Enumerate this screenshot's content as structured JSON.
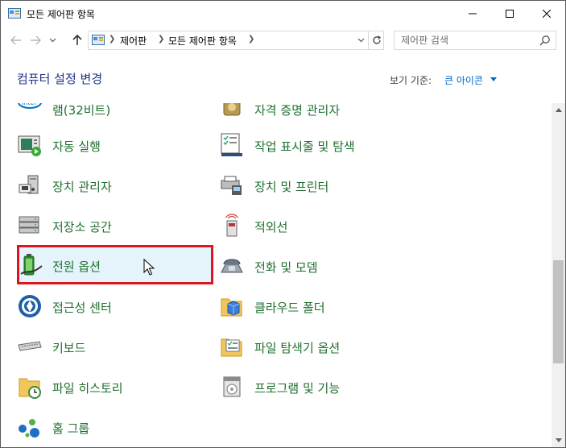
{
  "window": {
    "title": "모든 제어판 항목",
    "controls": {
      "minimize": "minimize",
      "maximize": "maximize",
      "close": "close"
    }
  },
  "address_bar": {
    "breadcrumbs": [
      "제어판",
      "모든 제어판 항목"
    ],
    "search_placeholder": "제어판 검색"
  },
  "header": {
    "title": "컴퓨터 설정 변경",
    "view_by_label": "보기 기준:",
    "view_by_value": "큰 아이콘"
  },
  "items_left": [
    {
      "label": "램(32비트)",
      "icon": "intel-graphics-icon"
    },
    {
      "label": "자동 실행",
      "icon": "autoplay-icon"
    },
    {
      "label": "장치 관리자",
      "icon": "device-manager-icon"
    },
    {
      "label": "저장소 공간",
      "icon": "storage-spaces-icon"
    },
    {
      "label": "전원 옵션",
      "icon": "power-options-icon",
      "selected": true
    },
    {
      "label": "접근성 센터",
      "icon": "ease-of-access-icon"
    },
    {
      "label": "키보드",
      "icon": "keyboard-icon"
    },
    {
      "label": "파일 히스토리",
      "icon": "file-history-icon"
    },
    {
      "label": "홈 그룹",
      "icon": "homegroup-icon"
    }
  ],
  "items_right": [
    {
      "label": "자격 증명 관리자",
      "icon": "credential-manager-icon"
    },
    {
      "label": "작업 표시줄 및 탐색",
      "icon": "taskbar-icon"
    },
    {
      "label": "장치 및 프린터",
      "icon": "devices-printers-icon"
    },
    {
      "label": "적외선",
      "icon": "infrared-icon"
    },
    {
      "label": "전화 및 모뎀",
      "icon": "phone-modem-icon"
    },
    {
      "label": "클라우드 폴더",
      "icon": "cloud-folder-icon"
    },
    {
      "label": "파일 탐색기 옵션",
      "icon": "file-explorer-options-icon"
    },
    {
      "label": "프로그램 및 기능",
      "icon": "programs-features-icon"
    }
  ],
  "scrollbar": {
    "position": 0.67
  }
}
